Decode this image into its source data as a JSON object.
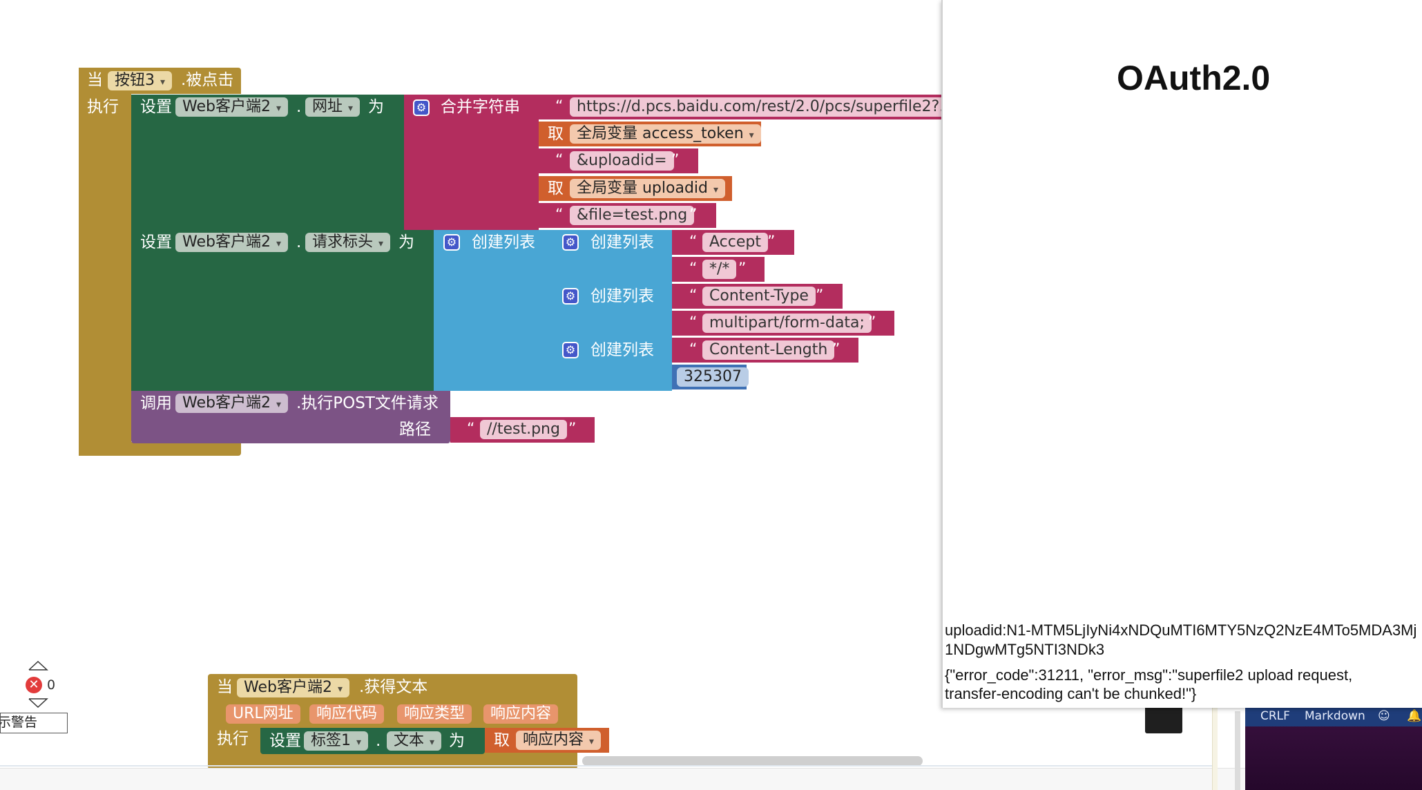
{
  "event_block": {
    "when": "当",
    "component": "按钮3",
    "event": ".被点击",
    "do": "执行",
    "set1": {
      "set": "设置",
      "component": "Web客户端2",
      "dot": ".",
      "property": "网址",
      "to": "为",
      "join_label": "合并字符串",
      "url": "https://d.pcs.baidu.com/rest/2.0/pcs/superfile2?...",
      "get1_label": "取",
      "get1_var": "全局变量 access_token",
      "str2": "&uploadid=",
      "get2_label": "取",
      "get2_var": "全局变量 uploadid",
      "str3": "&file=test.png"
    },
    "set2": {
      "set": "设置",
      "component": "Web客户端2",
      "dot": ".",
      "property": "请求标头",
      "to": "为",
      "make_list": "创建列表",
      "lists": [
        {
          "label": "创建列表",
          "key": "Accept",
          "value": "*/*"
        },
        {
          "label": "创建列表",
          "key": "Content-Type",
          "value": "multipart/form-data;"
        },
        {
          "label": "创建列表",
          "key": "Content-Length",
          "value": "325307"
        }
      ]
    },
    "call": {
      "call": "调用",
      "component": "Web客户端2",
      "method": ".执行POST文件请求",
      "path_label": "路径",
      "path": "//test.png"
    }
  },
  "event_block2": {
    "when": "当",
    "component": "Web客户端2",
    "event": ".获得文本",
    "params": [
      "URL网址",
      "响应代码",
      "响应类型",
      "响应内容"
    ],
    "do": "执行",
    "set": "设置",
    "target": "标签1",
    "dot": ".",
    "property": "文本",
    "to": "为",
    "get_label": "取",
    "get_var": "响应内容"
  },
  "warnings": {
    "count": "0",
    "label": "示警告"
  },
  "phone": {
    "title": "OAuth2.0",
    "uploadid_line": "uploadid:N1-MTM5LjIyNi4xNDQuMTI6MTY5NzQ2NzE4MTo5MDA3MjIzMzU0NDgwMTg5NTI3NDk3",
    "uploadid_line1": "uploadid:N1-MTM5LjIyNi4xNDQuMTI6MTY5NzQ2NzE4MTo5MDA3Mj",
    "uploadid_line2": "1NDgwMTg5NTI3NDk3",
    "response_line1": "{\"error_code\":31211, \"error_msg\":\"superfile2 upload request,",
    "response_line2": "transfer-encoding can't be chunked!\"}"
  },
  "statusbar": {
    "crlf": "CRLF",
    "mode": "Markdown"
  },
  "colors": {
    "event": "#b18e35",
    "set_green": "#266744",
    "text_magenta": "#b32d5e",
    "variable_orange": "#d05f2d",
    "list_blue": "#49a6d4",
    "call_purple": "#7c5385",
    "number_blue": "#3f71b5"
  }
}
